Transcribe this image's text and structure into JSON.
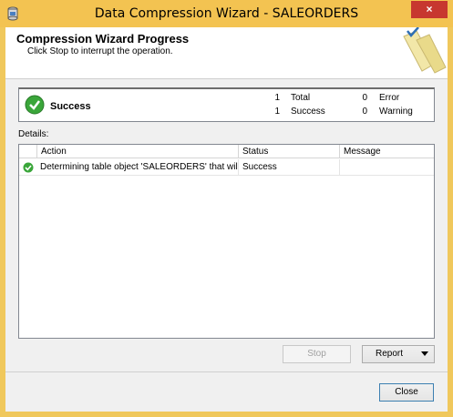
{
  "window": {
    "title": "Data Compression Wizard - SALEORDERS",
    "close_glyph": "×",
    "icon": "database-wizard-icon"
  },
  "header": {
    "title": "Compression Wizard Progress",
    "subtitle": "Click Stop to interrupt the operation."
  },
  "summary": {
    "status": "Success",
    "total_count": "1",
    "total_label": "Total",
    "success_count": "1",
    "success_label": "Success",
    "error_count": "0",
    "error_label": "Error",
    "warning_count": "0",
    "warning_label": "Warning"
  },
  "details": {
    "label": "Details:",
    "columns": [
      "Action",
      "Status",
      "Message"
    ],
    "rows": [
      {
        "action": "Determining table object 'SALEORDERS' that will be...",
        "status": "Success",
        "message": ""
      }
    ]
  },
  "buttons": {
    "stop": "Stop",
    "report": "Report",
    "close": "Close"
  },
  "colors": {
    "titlebar": "#f3c351",
    "close_button": "#c7372f",
    "success_green": "#3aa63a"
  }
}
